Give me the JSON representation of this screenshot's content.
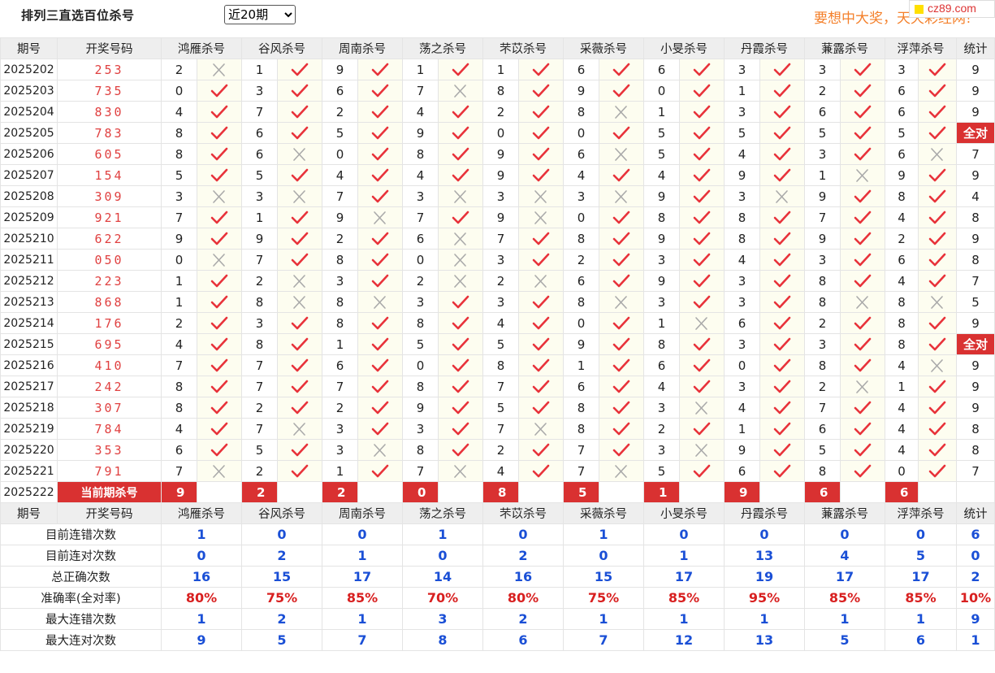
{
  "header": {
    "title": "排列三直选百位杀号",
    "period_selected": "近20期",
    "slogan": "要想中大奖，天天彩经网!",
    "logo": "cz89.com"
  },
  "table": {
    "columns": [
      "期号",
      "开奖号码",
      "鸿雁杀号",
      "谷风杀号",
      "周南杀号",
      "荡之杀号",
      "芣苡杀号",
      "采薇杀号",
      "小旻杀号",
      "丹霞杀号",
      "蒹露杀号",
      "浮萍杀号",
      "统计"
    ],
    "rows": [
      {
        "issue": "2025202",
        "draw": "253",
        "kills": [
          2,
          1,
          9,
          1,
          1,
          6,
          6,
          3,
          3,
          3
        ],
        "ok": [
          0,
          1,
          1,
          1,
          1,
          1,
          1,
          1,
          1,
          1
        ],
        "stat": "9"
      },
      {
        "issue": "2025203",
        "draw": "735",
        "kills": [
          0,
          3,
          6,
          7,
          8,
          9,
          0,
          1,
          2,
          6
        ],
        "ok": [
          1,
          1,
          1,
          0,
          1,
          1,
          1,
          1,
          1,
          1
        ],
        "stat": "9"
      },
      {
        "issue": "2025204",
        "draw": "830",
        "kills": [
          4,
          7,
          2,
          4,
          2,
          8,
          1,
          3,
          6,
          6
        ],
        "ok": [
          1,
          1,
          1,
          1,
          1,
          0,
          1,
          1,
          1,
          1
        ],
        "stat": "9"
      },
      {
        "issue": "2025205",
        "draw": "783",
        "kills": [
          8,
          6,
          5,
          9,
          0,
          0,
          5,
          5,
          5,
          5
        ],
        "ok": [
          1,
          1,
          1,
          1,
          1,
          1,
          1,
          1,
          1,
          1
        ],
        "stat": "全对"
      },
      {
        "issue": "2025206",
        "draw": "605",
        "kills": [
          8,
          6,
          0,
          8,
          9,
          6,
          5,
          4,
          3,
          6
        ],
        "ok": [
          1,
          0,
          1,
          1,
          1,
          0,
          1,
          1,
          1,
          0
        ],
        "stat": "7"
      },
      {
        "issue": "2025207",
        "draw": "154",
        "kills": [
          5,
          5,
          4,
          4,
          9,
          4,
          4,
          9,
          1,
          9
        ],
        "ok": [
          1,
          1,
          1,
          1,
          1,
          1,
          1,
          1,
          0,
          1
        ],
        "stat": "9"
      },
      {
        "issue": "2025208",
        "draw": "309",
        "kills": [
          3,
          3,
          7,
          3,
          3,
          3,
          9,
          3,
          9,
          8
        ],
        "ok": [
          0,
          0,
          1,
          0,
          0,
          0,
          1,
          0,
          1,
          1
        ],
        "stat": "4"
      },
      {
        "issue": "2025209",
        "draw": "921",
        "kills": [
          7,
          1,
          9,
          7,
          9,
          0,
          8,
          8,
          7,
          4
        ],
        "ok": [
          1,
          1,
          0,
          1,
          0,
          1,
          1,
          1,
          1,
          1
        ],
        "stat": "8"
      },
      {
        "issue": "2025210",
        "draw": "622",
        "kills": [
          9,
          9,
          2,
          6,
          7,
          8,
          9,
          8,
          9,
          2
        ],
        "ok": [
          1,
          1,
          1,
          0,
          1,
          1,
          1,
          1,
          1,
          1
        ],
        "stat": "9"
      },
      {
        "issue": "2025211",
        "draw": "050",
        "kills": [
          0,
          7,
          8,
          0,
          3,
          2,
          3,
          4,
          3,
          6
        ],
        "ok": [
          0,
          1,
          1,
          0,
          1,
          1,
          1,
          1,
          1,
          1
        ],
        "stat": "8"
      },
      {
        "issue": "2025212",
        "draw": "223",
        "kills": [
          1,
          2,
          3,
          2,
          2,
          6,
          9,
          3,
          8,
          4
        ],
        "ok": [
          1,
          0,
          1,
          0,
          0,
          1,
          1,
          1,
          1,
          1
        ],
        "stat": "7"
      },
      {
        "issue": "2025213",
        "draw": "868",
        "kills": [
          1,
          8,
          8,
          3,
          3,
          8,
          3,
          3,
          8,
          8
        ],
        "ok": [
          1,
          0,
          0,
          1,
          1,
          0,
          1,
          1,
          0,
          0
        ],
        "stat": "5"
      },
      {
        "issue": "2025214",
        "draw": "176",
        "kills": [
          2,
          3,
          8,
          8,
          4,
          0,
          1,
          6,
          2,
          8
        ],
        "ok": [
          1,
          1,
          1,
          1,
          1,
          1,
          0,
          1,
          1,
          1
        ],
        "stat": "9"
      },
      {
        "issue": "2025215",
        "draw": "695",
        "kills": [
          4,
          8,
          1,
          5,
          5,
          9,
          8,
          3,
          3,
          8
        ],
        "ok": [
          1,
          1,
          1,
          1,
          1,
          1,
          1,
          1,
          1,
          1
        ],
        "stat": "全对"
      },
      {
        "issue": "2025216",
        "draw": "410",
        "kills": [
          7,
          7,
          6,
          0,
          8,
          1,
          6,
          0,
          8,
          4
        ],
        "ok": [
          1,
          1,
          1,
          1,
          1,
          1,
          1,
          1,
          1,
          0
        ],
        "stat": "9"
      },
      {
        "issue": "2025217",
        "draw": "242",
        "kills": [
          8,
          7,
          7,
          8,
          7,
          6,
          4,
          3,
          2,
          1
        ],
        "ok": [
          1,
          1,
          1,
          1,
          1,
          1,
          1,
          1,
          0,
          1
        ],
        "stat": "9"
      },
      {
        "issue": "2025218",
        "draw": "307",
        "kills": [
          8,
          2,
          2,
          9,
          5,
          8,
          3,
          4,
          7,
          4
        ],
        "ok": [
          1,
          1,
          1,
          1,
          1,
          1,
          0,
          1,
          1,
          1
        ],
        "stat": "9"
      },
      {
        "issue": "2025219",
        "draw": "784",
        "kills": [
          4,
          7,
          3,
          3,
          7,
          8,
          2,
          1,
          6,
          4
        ],
        "ok": [
          1,
          0,
          1,
          1,
          0,
          1,
          1,
          1,
          1,
          1
        ],
        "stat": "8"
      },
      {
        "issue": "2025220",
        "draw": "353",
        "kills": [
          6,
          5,
          3,
          8,
          2,
          7,
          3,
          9,
          5,
          4
        ],
        "ok": [
          1,
          1,
          0,
          1,
          1,
          1,
          0,
          1,
          1,
          1
        ],
        "stat": "8"
      },
      {
        "issue": "2025221",
        "draw": "791",
        "kills": [
          7,
          2,
          1,
          7,
          4,
          7,
          5,
          6,
          8,
          0
        ],
        "ok": [
          0,
          1,
          1,
          0,
          1,
          0,
          1,
          1,
          1,
          1
        ],
        "stat": "7"
      }
    ],
    "current": {
      "issue": "2025222",
      "label": "当前期杀号",
      "kills": [
        "9",
        "2",
        "2",
        "0",
        "8",
        "5",
        "1",
        "9",
        "6",
        "6"
      ]
    },
    "stats": [
      {
        "label": "目前连错次数",
        "values": [
          "1",
          "0",
          "0",
          "1",
          "0",
          "1",
          "0",
          "0",
          "0",
          "0"
        ],
        "total": "6",
        "style": "blue"
      },
      {
        "label": "目前连对次数",
        "values": [
          "0",
          "2",
          "1",
          "0",
          "2",
          "0",
          "1",
          "13",
          "4",
          "5"
        ],
        "total": "0",
        "style": "blue"
      },
      {
        "label": "总正确次数",
        "values": [
          "16",
          "15",
          "17",
          "14",
          "16",
          "15",
          "17",
          "19",
          "17",
          "17"
        ],
        "total": "2",
        "style": "blue"
      },
      {
        "label": "准确率(全对率)",
        "values": [
          "80%",
          "75%",
          "85%",
          "70%",
          "80%",
          "75%",
          "85%",
          "95%",
          "85%",
          "85%"
        ],
        "total": "10%",
        "style": "red"
      },
      {
        "label": "最大连错次数",
        "values": [
          "1",
          "2",
          "1",
          "3",
          "2",
          "1",
          "1",
          "1",
          "1",
          "1"
        ],
        "total": "9",
        "style": "blue"
      },
      {
        "label": "最大连对次数",
        "values": [
          "9",
          "5",
          "7",
          "8",
          "6",
          "7",
          "12",
          "13",
          "5",
          "6"
        ],
        "total": "1",
        "style": "blue"
      }
    ]
  },
  "colors": {
    "accent_red": "#d93131",
    "check_red": "#e8323a",
    "cross_gray": "#aaaaaa",
    "stat_blue": "#1a4fd6",
    "slogan_orange": "#f4802b"
  },
  "icons": {
    "ok": "check-icon",
    "wrong": "cross-icon"
  }
}
